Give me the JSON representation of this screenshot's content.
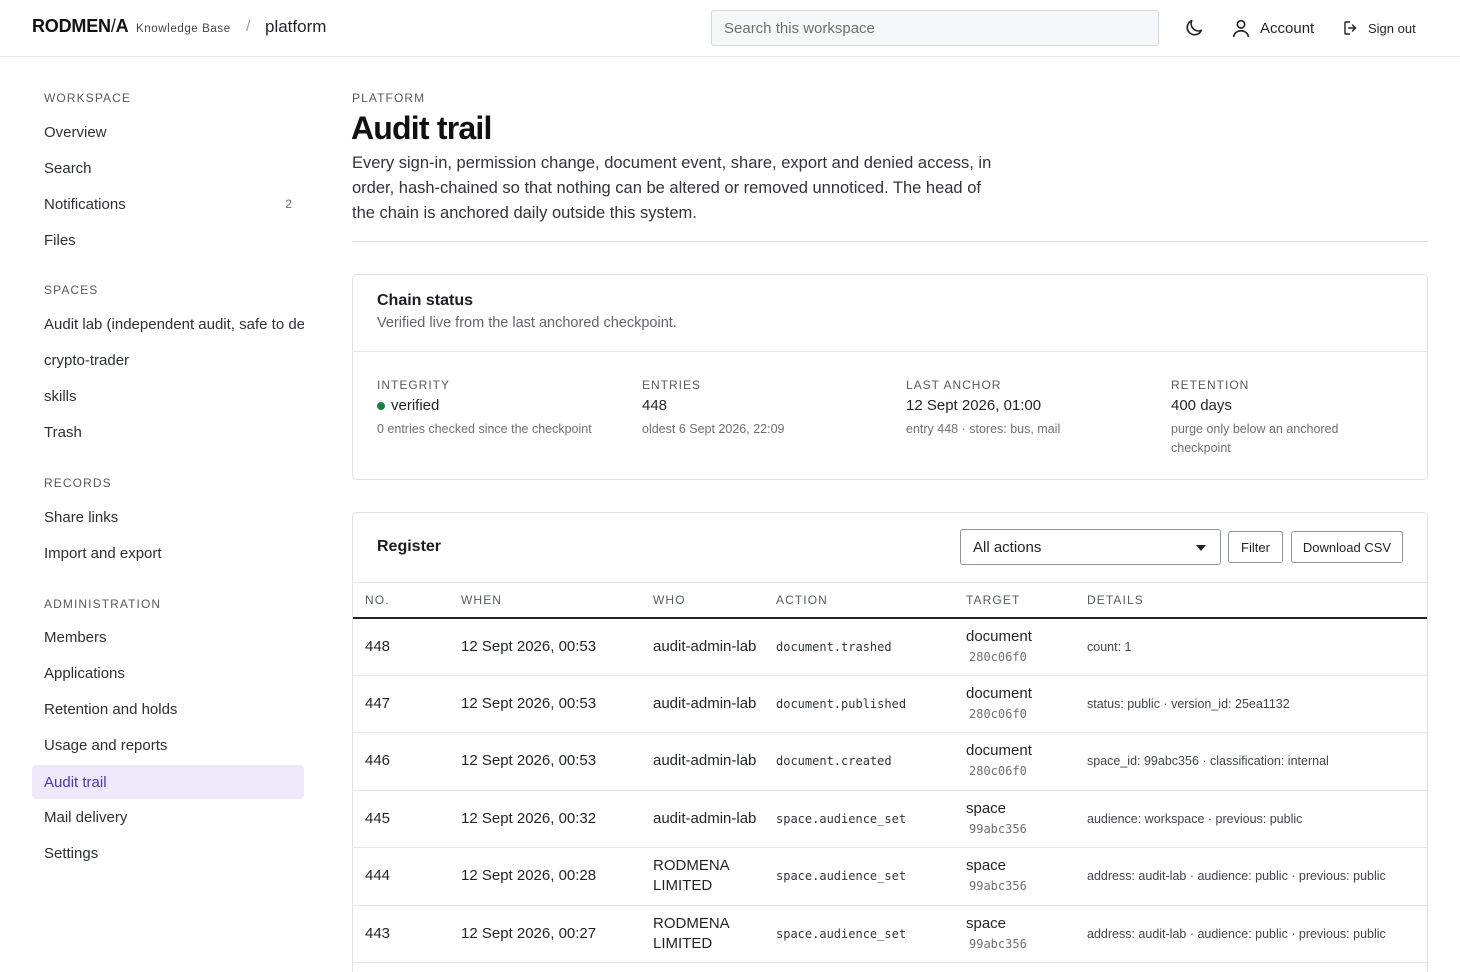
{
  "header": {
    "brand": "RODMEN",
    "brand_slash": "/",
    "brand_end": "A",
    "brand_sub": "Knowledge Base",
    "crumb_sep": "/",
    "crumb": "platform",
    "search_placeholder": "Search this workspace",
    "theme_icon": "moon-icon",
    "account_label": "Account",
    "signout_label": "Sign out"
  },
  "sidebar": {
    "workspace": {
      "heading": "WORKSPACE",
      "items": [
        {
          "label": "Overview"
        },
        {
          "label": "Search"
        },
        {
          "label": "Notifications",
          "badge": "2"
        },
        {
          "label": "Files"
        }
      ]
    },
    "spaces": {
      "heading": "SPACES",
      "items": [
        {
          "label": "Audit lab (independent audit, safe to de"
        },
        {
          "label": "crypto-trader"
        },
        {
          "label": "skills"
        },
        {
          "label": "Trash"
        }
      ]
    },
    "records": {
      "heading": "RECORDS",
      "items": [
        {
          "label": "Share links"
        },
        {
          "label": "Import and export"
        }
      ]
    },
    "administration": {
      "heading": "ADMINISTRATION",
      "items": [
        {
          "label": "Members"
        },
        {
          "label": "Applications"
        },
        {
          "label": "Retention and holds"
        },
        {
          "label": "Usage and reports"
        },
        {
          "label": "Audit trail",
          "active": true
        },
        {
          "label": "Mail delivery"
        },
        {
          "label": "Settings"
        }
      ]
    }
  },
  "main": {
    "eyebrow": "PLATFORM",
    "title": "Audit trail",
    "description": "Every sign-in, permission change, document event, share, export and denied access, in order, hash-chained so that nothing can be altered or removed unnoticed. The head of the chain is anchored daily outside this system.",
    "chain_status": {
      "title": "Chain status",
      "subtitle": "Verified live from the last anchored checkpoint.",
      "stats": [
        {
          "label": "INTEGRITY",
          "value": "verified",
          "note": "0 entries checked since the checkpoint"
        },
        {
          "label": "ENTRIES",
          "value": "448",
          "note": "oldest 6 Sept 2026, 22:09"
        },
        {
          "label": "LAST ANCHOR",
          "value": "12 Sept 2026, 01:00",
          "note": "entry 448 · stores: bus, mail"
        },
        {
          "label": "RETENTION",
          "value": "400 days",
          "note": "purge only below an anchored checkpoint"
        }
      ],
      "integrity_color": "#1a7f4b"
    },
    "register": {
      "title": "Register",
      "filter_select": "All actions",
      "filter_button": "Filter",
      "download_button": "Download CSV",
      "columns": [
        "NO.",
        "WHEN",
        "WHO",
        "ACTION",
        "TARGET",
        "DETAILS"
      ],
      "rows": [
        {
          "no": "448",
          "when": "12 Sept 2026, 00:53",
          "who": "audit-admin-lab",
          "action": "document.trashed",
          "target": "document",
          "target_id": "280c06f0",
          "details": "count: 1"
        },
        {
          "no": "447",
          "when": "12 Sept 2026, 00:53",
          "who": "audit-admin-lab",
          "action": "document.published",
          "target": "document",
          "target_id": "280c06f0",
          "details": "status: public · version_id: 25ea1132"
        },
        {
          "no": "446",
          "when": "12 Sept 2026, 00:53",
          "who": "audit-admin-lab",
          "action": "document.created",
          "target": "document",
          "target_id": "280c06f0",
          "details": "space_id: 99abc356 · classification: internal"
        },
        {
          "no": "445",
          "when": "12 Sept 2026, 00:32",
          "who": "audit-admin-lab",
          "action": "space.audience_set",
          "target": "space",
          "target_id": "99abc356",
          "details": "audience: workspace · previous: public"
        },
        {
          "no": "444",
          "when": "12 Sept 2026, 00:28",
          "who": "RODMENA LIMITED",
          "action": "space.audience_set",
          "target": "space",
          "target_id": "99abc356",
          "details": "address: audit-lab · audience: public · previous: public"
        },
        {
          "no": "443",
          "when": "12 Sept 2026, 00:27",
          "who": "RODMENA LIMITED",
          "action": "space.audience_set",
          "target": "space",
          "target_id": "99abc356",
          "details": "address: audit-lab · audience: public · previous: public"
        }
      ]
    }
  }
}
